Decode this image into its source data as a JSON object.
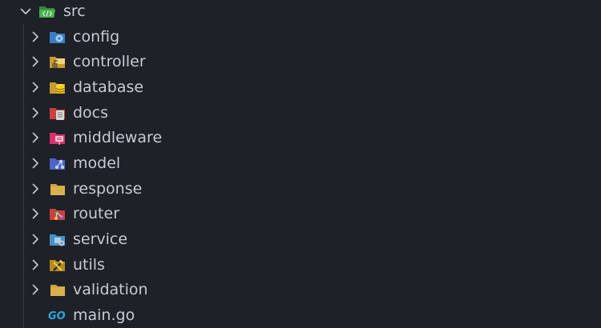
{
  "explorer": {
    "root": {
      "label": "src",
      "expanded": true,
      "icon": "folder-src-open-icon"
    },
    "items": [
      {
        "label": "config",
        "icon": "folder-config-icon",
        "type": "folder"
      },
      {
        "label": "controller",
        "icon": "folder-controller-icon",
        "type": "folder"
      },
      {
        "label": "database",
        "icon": "folder-database-icon",
        "type": "folder"
      },
      {
        "label": "docs",
        "icon": "folder-docs-icon",
        "type": "folder"
      },
      {
        "label": "middleware",
        "icon": "folder-middleware-icon",
        "type": "folder"
      },
      {
        "label": "model",
        "icon": "folder-model-icon",
        "type": "folder"
      },
      {
        "label": "response",
        "icon": "folder-icon",
        "type": "folder"
      },
      {
        "label": "router",
        "icon": "folder-router-icon",
        "type": "folder"
      },
      {
        "label": "service",
        "icon": "folder-service-icon",
        "type": "folder"
      },
      {
        "label": "utils",
        "icon": "folder-utils-icon",
        "type": "folder"
      },
      {
        "label": "validation",
        "icon": "folder-icon",
        "type": "folder"
      },
      {
        "label": "main.go",
        "icon": "go-file-icon",
        "type": "file"
      }
    ]
  },
  "colors": {
    "background": "#1e2127",
    "text": "#c6cbd4",
    "chevron": "#c6cbd4",
    "guide": "#363b45"
  }
}
